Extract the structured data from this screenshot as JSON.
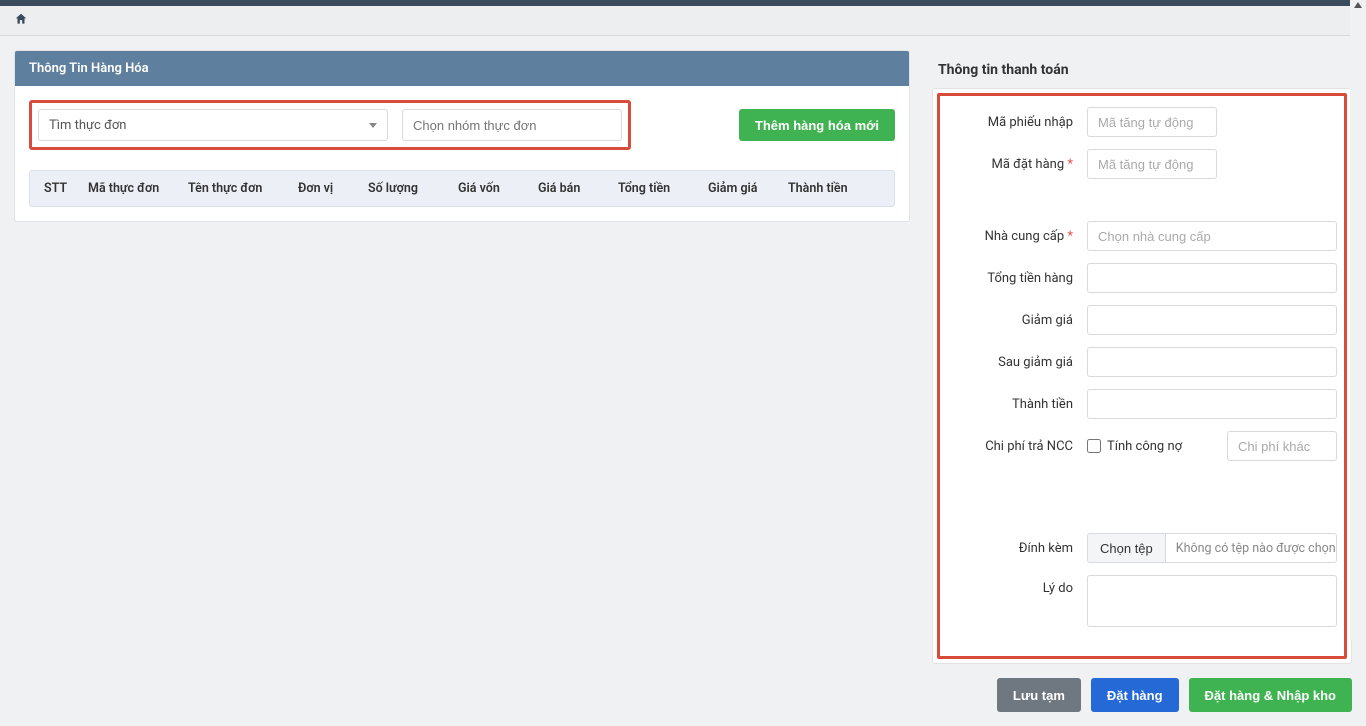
{
  "left_panel": {
    "title": "Thông Tin Hàng Hóa",
    "search_menu_placeholder": "Tìm thực đơn",
    "group_menu_placeholder": "Chọn nhóm thực đơn",
    "add_button": "Thêm hàng hóa mới",
    "columns": {
      "stt": "STT",
      "code": "Mã thực đơn",
      "name": "Tên thực đơn",
      "unit": "Đơn vị",
      "qty": "Số lượng",
      "cost": "Giá vốn",
      "price": "Giá bán",
      "line_total": "Tổng tiền",
      "discount": "Giảm giá",
      "final": "Thành tiền"
    }
  },
  "right_panel": {
    "title": "Thông tin thanh toán",
    "labels": {
      "receipt_code": "Mã phiếu nhập",
      "order_code": "Mã đặt hàng",
      "supplier": "Nhà cung cấp",
      "subtotal": "Tổng tiền hàng",
      "discount": "Giảm giá",
      "after_discount": "Sau giảm giá",
      "total": "Thành tiền",
      "supplier_cost": "Chi phí trả NCC",
      "debt_check": "Tính công nợ",
      "other_cost_placeholder": "Chi phí khác",
      "attach": "Đính kèm",
      "file_button": "Chọn tệp",
      "file_none": "Không có tệp nào được chọn",
      "reason": "Lý do"
    },
    "placeholders": {
      "auto_increment": "Mã tăng tự động",
      "choose_supplier": "Chọn nhà cung cấp"
    }
  },
  "actions": {
    "draft": "Lưu tạm",
    "order": "Đặt hàng",
    "order_and_import": "Đặt hàng & Nhập kho"
  }
}
